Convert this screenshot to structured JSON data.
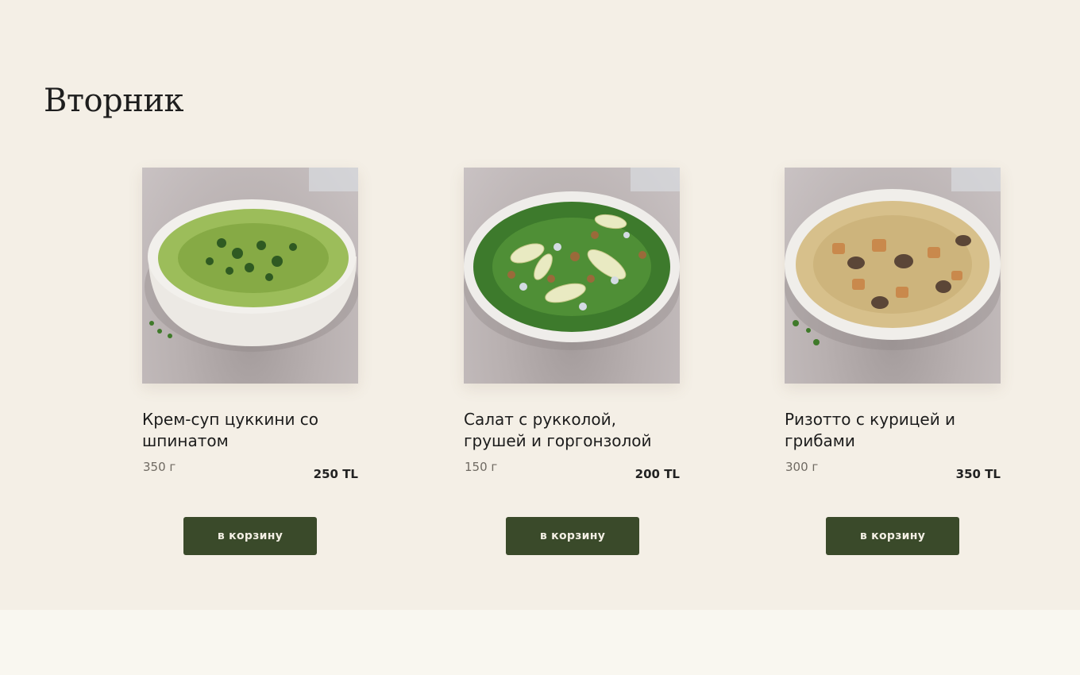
{
  "day": {
    "title": "Вторник"
  },
  "dishes": [
    {
      "name": "Крем-суп цуккини со шпинатом",
      "weight": "350 г",
      "price": "250 TL",
      "button": "в корзину",
      "image": "green-soup-bowl"
    },
    {
      "name": "Салат с рукколой, грушей и горгонзолой",
      "weight": "150 г",
      "price": "200 TL",
      "button": "в корзину",
      "image": "arugula-pear-salad-bowl"
    },
    {
      "name": "Ризотто с курицей и грибами",
      "weight": "300 г",
      "price": "350 TL",
      "button": "в корзину",
      "image": "chicken-mushroom-risotto-bowl"
    }
  ],
  "colors": {
    "background": "#f4efe6",
    "footer": "#f9f7f0",
    "button": "#3a4a2a",
    "button_text": "#f3efe4"
  }
}
